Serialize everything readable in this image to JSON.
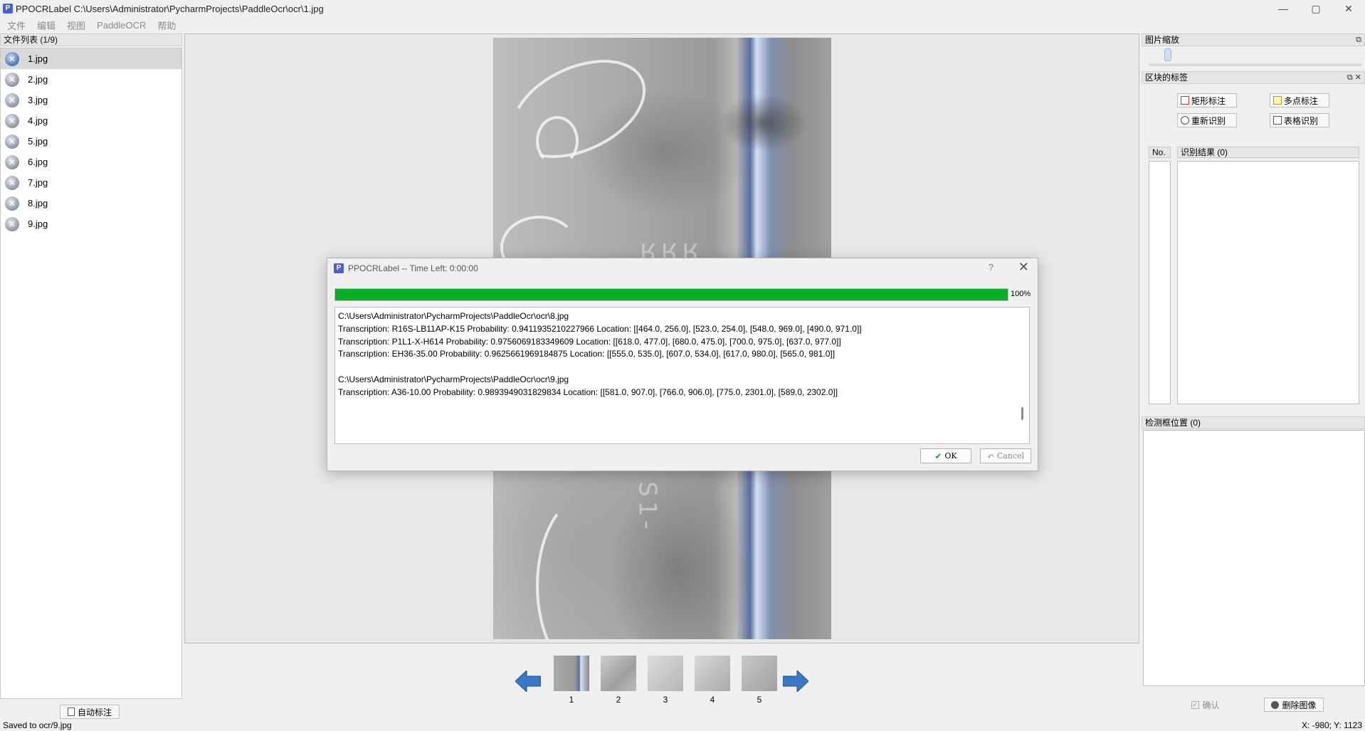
{
  "window": {
    "title": "PPOCRLabel C:\\Users\\Administrator\\PycharmProjects\\PaddleOcr\\ocr\\1.jpg",
    "icon_letter": "P",
    "controls": [
      "—",
      "▢",
      "✕"
    ]
  },
  "menu": [
    "文件",
    "编辑",
    "视图",
    "PaddleOCR",
    "帮助"
  ],
  "file_dock": {
    "title": "文件列表 (1/9)",
    "files": [
      "1.jpg",
      "2.jpg",
      "3.jpg",
      "4.jpg",
      "5.jpg",
      "6.jpg",
      "7.jpg",
      "8.jpg",
      "9.jpg"
    ],
    "selected_index": 0
  },
  "auto_label_button": "自动标注",
  "status": {
    "message": "Saved to  ocr/9.jpg",
    "coords": "X: -980; Y: 1123"
  },
  "thumbnails": [
    "1",
    "2",
    "3",
    "4",
    "5"
  ],
  "right_panel": {
    "zoom_title": "图片缩放",
    "labels_title": "区块的标签",
    "buttons": {
      "rect": "矩形标注",
      "poly": "多点标注",
      "reocr": "重新识别",
      "table": "表格识别"
    },
    "result_header_no": "No.",
    "result_header_text": "识别结果 (0)",
    "detbox_title": "检测框位置 (0)",
    "confirm": "确认",
    "delete_image": "删除图像"
  },
  "dialog": {
    "title": "PPOCRLabel  --  Time Left: 0:00:00",
    "help": "?",
    "close": "✕",
    "progress": 100,
    "progress_text": "100%",
    "log_lines": [
      "C:\\Users\\Administrator\\PycharmProjects\\PaddleOcr\\ocr\\8.jpg",
      "Transcription: R16S-LB11AP-K15 Probability: 0.9411935210227966 Location: [[464.0, 256.0], [523.0, 254.0], [548.0, 969.0], [490.0, 971.0]]",
      "Transcription: P1L1-X-H614 Probability: 0.9756069183349609 Location: [[618.0, 477.0], [680.0, 475.0], [700.0, 975.0], [637.0, 977.0]]",
      "Transcription: EH36-35.00 Probability: 0.9625661969184875 Location: [[555.0, 535.0], [607.0, 534.0], [617.0, 980.0], [565.0, 981.0]]",
      "",
      "C:\\Users\\Administrator\\PycharmProjects\\PaddleOcr\\ocr\\9.jpg",
      "Transcription: A36-10.00 Probability: 0.9893949031829834 Location: [[581.0, 907.0], [766.0, 906.0], [775.0, 2301.0], [589.0, 2302.0]]"
    ],
    "ok": "OK",
    "cancel": "Cancel"
  }
}
